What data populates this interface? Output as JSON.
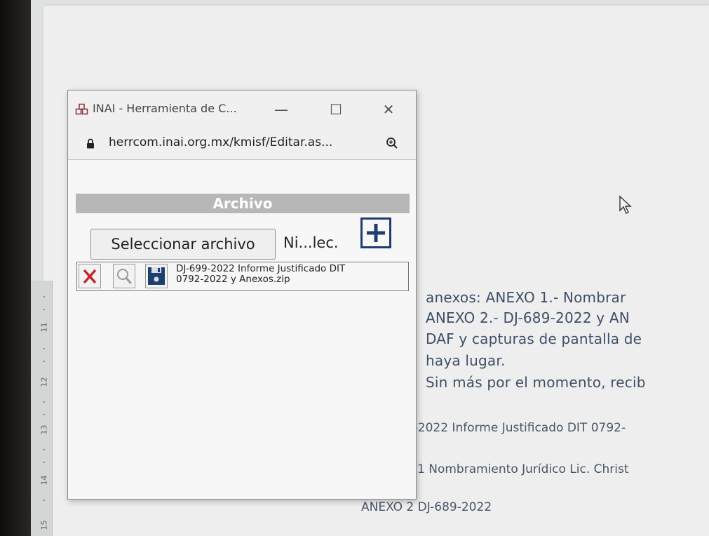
{
  "popup": {
    "title": "INAI - Herramienta de C...",
    "minimize": "—",
    "maximize": "☐",
    "close": "✕",
    "url": "herrcom.inai.org.mx/kmisf/Editar.as..."
  },
  "form": {
    "section_title": "Archivo",
    "select_label": "Seleccionar archivo",
    "no_file_text": "Ni...lec.",
    "file_name_line1": "DJ-699-2022 Informe Justificado DIT",
    "file_name_line2": "0792-2022 y Anexos.zip"
  },
  "document": {
    "line1": "anexos:  ANEXO  1.-  Nombrar",
    "line2": "ANEXO 2.- DJ-689-2022 y AN",
    "line3": "DAF y capturas de pantalla de",
    "line4": "haya lugar.",
    "line5": "Sin más por el momento, recib",
    "attach1": ")-2022 Informe Justificado DIT 0792-",
    "attach2": ") 1 Nombramiento Jurídico Lic. Christ",
    "attach3": "ANEXO 2 DJ-689-2022"
  },
  "ruler": [
    "11",
    "12",
    "13",
    "14",
    "15"
  ],
  "colors": {
    "accent": "#1f3e70",
    "danger": "#c0272d",
    "header_bg": "#b7b7b7",
    "icon_title": "#8a2f3d"
  },
  "icons": [
    "app-icon",
    "lock-icon",
    "zoom-icon",
    "add-icon",
    "delete-icon",
    "search-icon",
    "save-icon",
    "mouse-cursor-icon"
  ]
}
